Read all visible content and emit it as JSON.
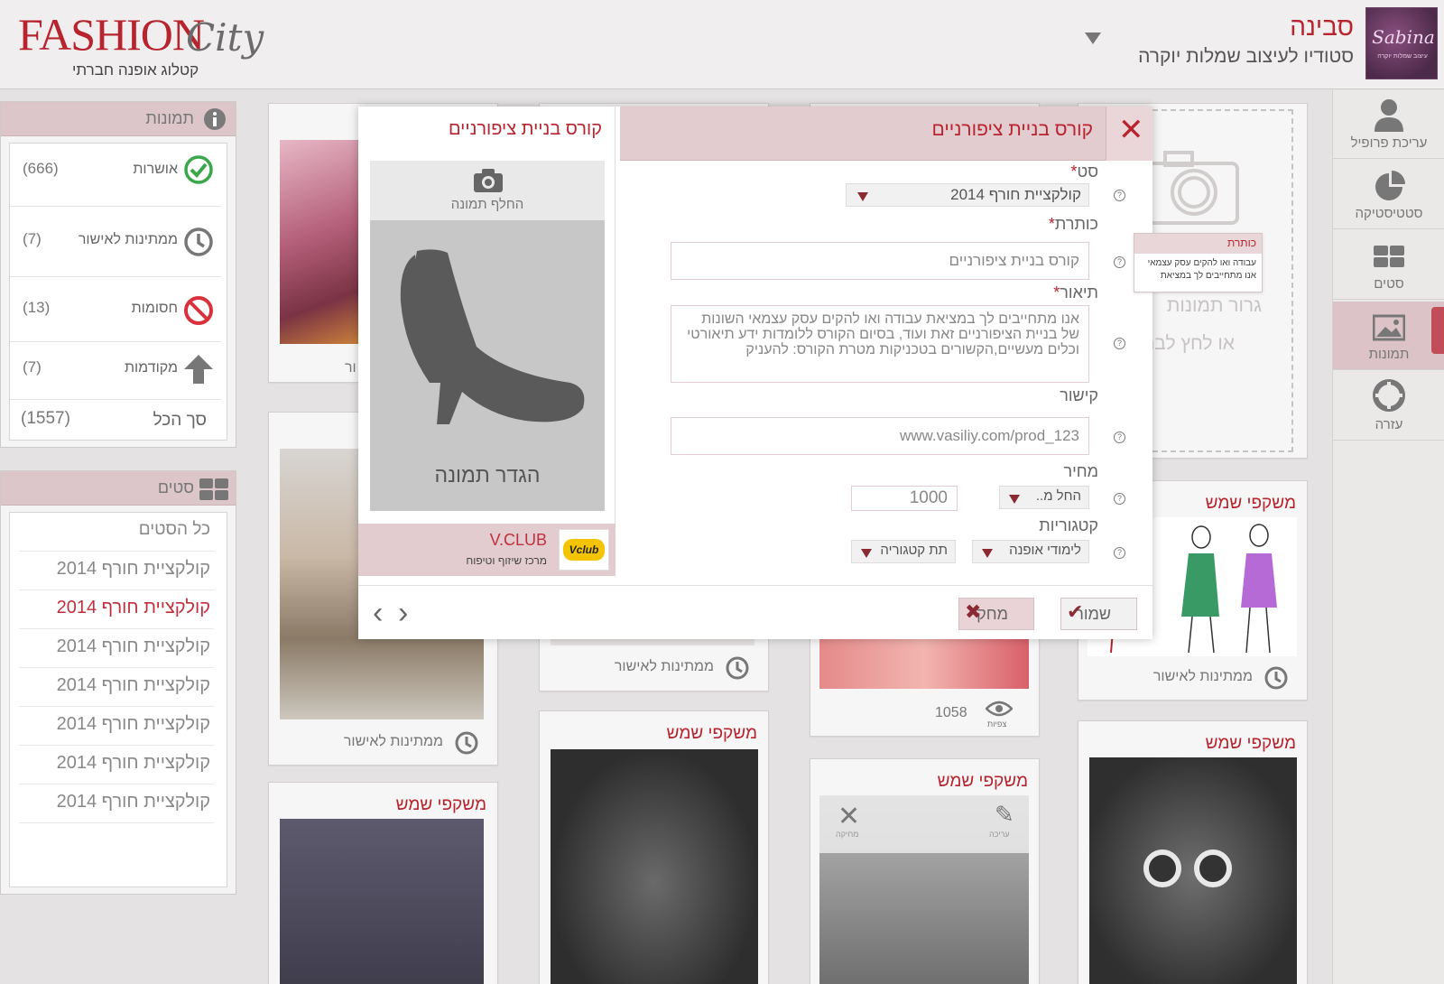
{
  "header": {
    "logo_main": "FASHION",
    "logo_city": "City",
    "logo_sub": "קטלוג אופנה חברתי",
    "brand_logo": "Sabina",
    "brand_logo_sub": "עיצוב שמלות יוקרה",
    "brand_name": "סבינה",
    "brand_desc": "סטודיו לעיצוב שמלות יוקרה"
  },
  "right_nav": {
    "items": [
      {
        "label": "עריכת פרופיל",
        "icon": "user-icon"
      },
      {
        "label": "סטטיסטיקה",
        "icon": "pie-chart-icon"
      },
      {
        "label": "סטים",
        "icon": "grid-icon"
      },
      {
        "label": "תמונות",
        "icon": "image-icon",
        "active": true
      },
      {
        "label": "עזרה",
        "icon": "lifebuoy-icon"
      }
    ]
  },
  "images_panel": {
    "title": "תמונות",
    "stats": [
      {
        "label": "אושרות",
        "count": "(666)",
        "icon": "check-circle-icon"
      },
      {
        "label": "ממתינות לאישור",
        "count": "(7)",
        "icon": "clock-icon"
      },
      {
        "label": "חסומות",
        "count": "(13)",
        "icon": "blocked-icon"
      },
      {
        "label": "מקודמות",
        "count": "(7)",
        "icon": "arrow-up-icon"
      },
      {
        "label": "סך הכל",
        "count": "(1557)"
      }
    ]
  },
  "sets_panel": {
    "title": "סטים",
    "all_label": "כל הסטים",
    "items": [
      "קולקציית חורף 2014",
      "קולקציית חורף 2014",
      "קולקציית חורף 2014",
      "קולקציית חורף 2014",
      "קולקציית חורף 2014",
      "קולקציית חורף 2014",
      "קולקציית חורף 2014"
    ],
    "active_index": 1
  },
  "background": {
    "upload_drop": "גרור תמונות",
    "upload_click": "או לחץ לבחי",
    "card_label_partial": "ור",
    "cards": [
      {
        "title": "משקפי שמש",
        "status": "ממתינות לאישור"
      },
      {
        "title": "משקפי שמש",
        "status": "ממתינות לאישור"
      },
      {
        "title": "משקפי שמש",
        "status": "ממתינות לאישור"
      },
      {
        "title": "משקפי שמש"
      },
      {
        "title": "משקפי שמש"
      },
      {
        "title": "משקפי שמש"
      },
      {
        "title": "משקפי שמש"
      }
    ],
    "views_count": "1058",
    "views_label": "צפיות",
    "edit_label": "עריכה",
    "delete_label": "מחיקה"
  },
  "modal": {
    "left_title": "קורס בניית ציפורניים",
    "change_image": "החלף תמונה",
    "set_image": "הגדר תמונה",
    "vendor_name": "V.CLUB",
    "vendor_sub": "מרכז שיזוף וטיפוח",
    "vendor_logo": "Vclub",
    "right_title": "קורס בניית ציפורניים",
    "close_icon": "✕",
    "form": {
      "set_label": "סט",
      "set_value": "קולקציית חורף 2014",
      "title_label": "כותרת",
      "title_value": "קורס בניית ציפורניים",
      "desc_label": "תיאור",
      "desc_value": "אנו מתחייבים לך במציאת עבודה ואו להקים עסק עצמאי השונות של בניית הציפורניים זאת ועוד, בסיום הקורס ללומדות ידע תיאורטי וכלים מעשיים,הקשורים בטכניקות מטרת הקורס: להעניק",
      "link_label": "קישור",
      "link_value": "www.vasiliy.com/prod_123",
      "price_label": "מחיר",
      "price_from": "החל מ..",
      "price_value": "1000",
      "categories_label": "קטגוריות",
      "category_value": "לימודי אופנה",
      "subcategory_value": "תת קטגוריה",
      "required_mark": "*",
      "help_glyph": "?"
    },
    "tooltip": {
      "title": "כותרת",
      "body": "עבודה ואו להקים עסק עצמאי אנו מתחייבים לך במציאת"
    },
    "footer": {
      "save_label": "שמור",
      "delete_label": "מחק",
      "prev_icon": "‹",
      "next_icon": "›"
    }
  },
  "colors": {
    "brand_red": "#b8242e",
    "panel_pink": "#ddc6ca",
    "approved_green": "#3aa84a",
    "blocked_red": "#d9323c",
    "icon_gray": "#777777"
  }
}
